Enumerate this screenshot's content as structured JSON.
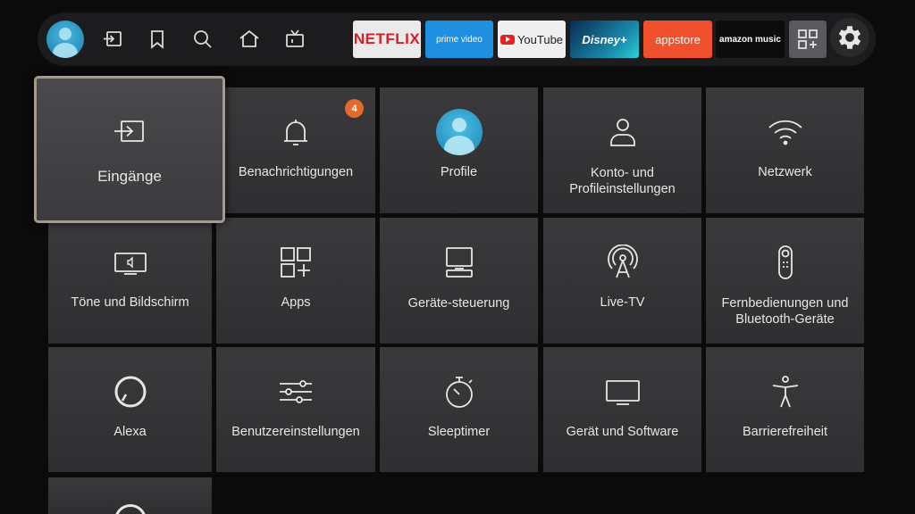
{
  "top_bar": {
    "nav": [
      {
        "icon": "input-icon"
      },
      {
        "icon": "bookmark-icon"
      },
      {
        "icon": "search-icon"
      },
      {
        "icon": "home-icon"
      },
      {
        "icon": "live-tv-icon"
      }
    ],
    "apps": [
      {
        "name": "netflix",
        "label": "NETFLIX"
      },
      {
        "name": "prime-video",
        "label": "prime video"
      },
      {
        "name": "youtube",
        "label": "YouTube"
      },
      {
        "name": "disney-plus",
        "label": "Disney+"
      },
      {
        "name": "appstore",
        "label": "appstore"
      },
      {
        "name": "amazon-music",
        "label": "amazon music"
      }
    ],
    "apps_grid_icon": "apps-grid-icon",
    "settings_icon": "gear-icon"
  },
  "settings": {
    "tiles": [
      {
        "label": "Eingänge",
        "icon": "input-icon",
        "focused": true
      },
      {
        "label": "Benachrichtigungen",
        "icon": "bell-icon",
        "badge": "4"
      },
      {
        "label": "Profile",
        "icon": "profile-avatar"
      },
      {
        "label": "Konto- und Profileinstellungen",
        "icon": "person-icon"
      },
      {
        "label": "Netzwerk",
        "icon": "wifi-icon"
      },
      {
        "label": "Töne und Bildschirm",
        "icon": "display-sound-icon"
      },
      {
        "label": "Apps",
        "icon": "apps-grid-icon"
      },
      {
        "label": "Geräte-steuerung",
        "icon": "device-control-icon"
      },
      {
        "label": "Live-TV",
        "icon": "antenna-icon"
      },
      {
        "label": "Fernbedienungen und Bluetooth-Geräte",
        "icon": "remote-icon"
      },
      {
        "label": "Alexa",
        "icon": "alexa-icon"
      },
      {
        "label": "Benutzereinstellungen",
        "icon": "sliders-icon"
      },
      {
        "label": "Sleeptimer",
        "icon": "stopwatch-icon"
      },
      {
        "label": "Gerät und Software",
        "icon": "tv-icon"
      },
      {
        "label": "Barrierefreiheit",
        "icon": "accessibility-icon"
      }
    ]
  },
  "colors": {
    "background": "#0b0b0c",
    "tile": "#353537",
    "focus_border": "#a89a8a",
    "badge": "#e5692a",
    "netflix": "#d81f26",
    "prime": "#1f8fe0",
    "appstore": "#f0502e"
  }
}
